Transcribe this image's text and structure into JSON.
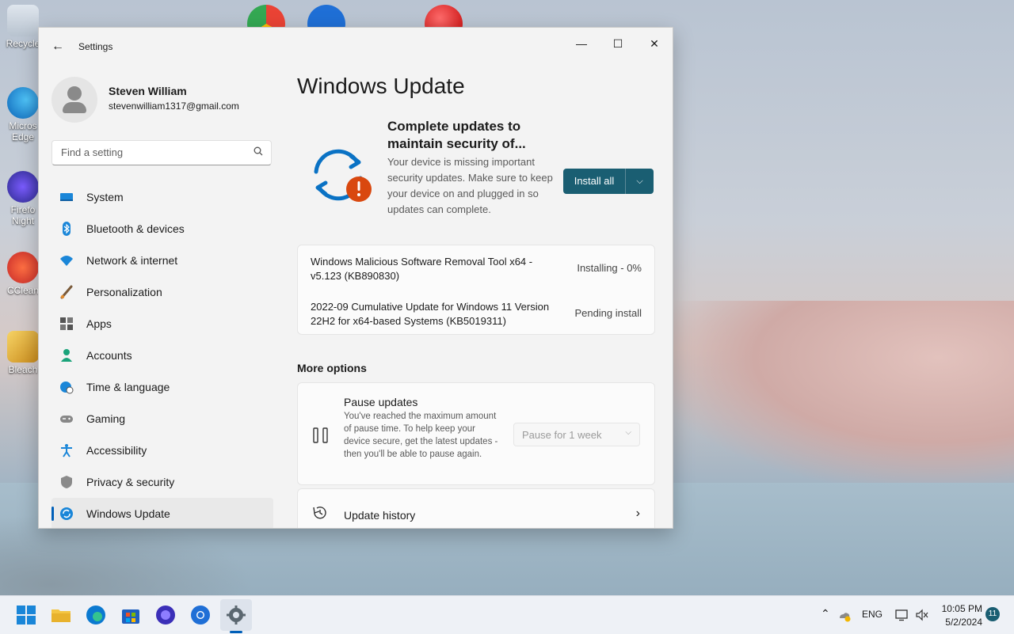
{
  "desktop": {
    "icons": [
      {
        "label": "Recycle"
      },
      {
        "label": "Micros Edge"
      },
      {
        "label": "Firefo Night"
      },
      {
        "label": "CClean"
      },
      {
        "label": "Bleach"
      }
    ]
  },
  "window": {
    "app_title": "Settings",
    "back_glyph": "←",
    "minimize_glyph": "—",
    "maximize_glyph": "☐",
    "close_glyph": "✕"
  },
  "profile": {
    "name": "Steven William",
    "email": "stevenwilliam1317@gmail.com"
  },
  "search": {
    "placeholder": "Find a setting"
  },
  "nav": [
    {
      "label": "System",
      "icon": "system-icon",
      "color": "#0078d4"
    },
    {
      "label": "Bluetooth & devices",
      "icon": "bluetooth-icon",
      "color": "#0078d4"
    },
    {
      "label": "Network & internet",
      "icon": "wifi-icon",
      "color": "#0078d4"
    },
    {
      "label": "Personalization",
      "icon": "paintbrush-icon",
      "color": "#c77d2e"
    },
    {
      "label": "Apps",
      "icon": "apps-icon",
      "color": "#444"
    },
    {
      "label": "Accounts",
      "icon": "accounts-icon",
      "color": "#1aa37a"
    },
    {
      "label": "Time & language",
      "icon": "globe-clock-icon",
      "color": "#0078d4"
    },
    {
      "label": "Gaming",
      "icon": "gamepad-icon",
      "color": "#777"
    },
    {
      "label": "Accessibility",
      "icon": "accessibility-icon",
      "color": "#0078d4"
    },
    {
      "label": "Privacy & security",
      "icon": "shield-icon",
      "color": "#777"
    },
    {
      "label": "Windows Update",
      "icon": "windows-update-icon",
      "color": "#0078d4",
      "active": true
    }
  ],
  "main": {
    "title": "Windows Update",
    "status_heading": "Complete updates to maintain security of...",
    "status_desc": "Your device is missing important security updates. Make sure to keep your device on and plugged in so updates can complete.",
    "install_label": "Install all",
    "updates": [
      {
        "name": "Windows Malicious Software Removal Tool x64 - v5.123 (KB890830)",
        "status": "Installing - 0%"
      },
      {
        "name": "2022-09 Cumulative Update for Windows 11 Version 22H2 for x64-based Systems (KB5019311)",
        "status": "Pending install"
      }
    ],
    "more_options": "More options",
    "pause": {
      "title": "Pause updates",
      "desc": "You've reached the maximum amount of pause time. To help keep your device secure, get the latest updates - then you'll be able to pause again.",
      "dropdown_value": "Pause for 1 week"
    },
    "history": {
      "label": "Update history",
      "chevron": "›"
    }
  },
  "taskbar": {
    "lang": "ENG",
    "time": "10:05 PM",
    "date": "5/2/2024",
    "notifications": "11"
  },
  "colors": {
    "accent": "#1a5e72",
    "update_orange": "#d9480f",
    "update_blue": "#0a72c4"
  }
}
